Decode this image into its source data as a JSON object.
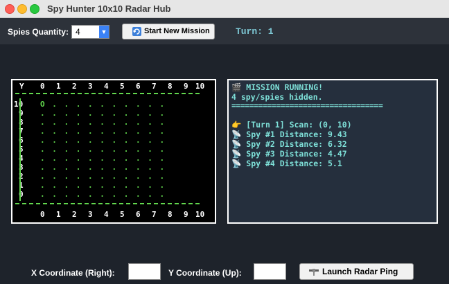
{
  "window": {
    "title": "Spy Hunter 10x10 Radar Hub"
  },
  "toolbar": {
    "spies_label": "Spies Quantity:",
    "spies_value": "4",
    "start_button": "Start New Mission",
    "turn_text": "Turn: 1"
  },
  "grid": {
    "header_y": "Y",
    "x_labels": [
      "0",
      "1",
      "2",
      "3",
      "4",
      "5",
      "6",
      "7",
      "8",
      "9",
      "10"
    ],
    "rows": [
      {
        "y": "10",
        "cells": "O . . . . . . . . . ."
      },
      {
        "y": "9",
        "cells": ". . . . . . . . . . ."
      },
      {
        "y": "8",
        "cells": ". . . . . . . . . . ."
      },
      {
        "y": "7",
        "cells": ". . . . . . . . . . ."
      },
      {
        "y": "6",
        "cells": ". . . . . . . . . . ."
      },
      {
        "y": "5",
        "cells": ". . . . . . . . . . ."
      },
      {
        "y": "4",
        "cells": ". . . . . . . . . . ."
      },
      {
        "y": "3",
        "cells": ". . . . . . . . . . ."
      },
      {
        "y": "2",
        "cells": ". . . . . . . . . . ."
      },
      {
        "y": "1",
        "cells": ". . . . . . . . . . ."
      },
      {
        "y": "0",
        "cells": ". . . . . . . . . . ."
      }
    ]
  },
  "log": {
    "status": "MISSION RUNNING!",
    "hidden": "4 spy/spies hidden.",
    "divider": "==================================",
    "scan": "[Turn 1] Scan: (0, 10)",
    "distances": [
      "Spy #1 Distance: 9.43",
      "Spy #2 Distance: 6.32",
      "Spy #3 Distance: 4.47",
      "Spy #4 Distance: 5.1"
    ]
  },
  "controls": {
    "x_label": "X Coordinate (Right):",
    "x_value": "",
    "y_label": "Y Coordinate (Up):",
    "y_value": "",
    "launch_button": "Launch Radar Ping"
  }
}
